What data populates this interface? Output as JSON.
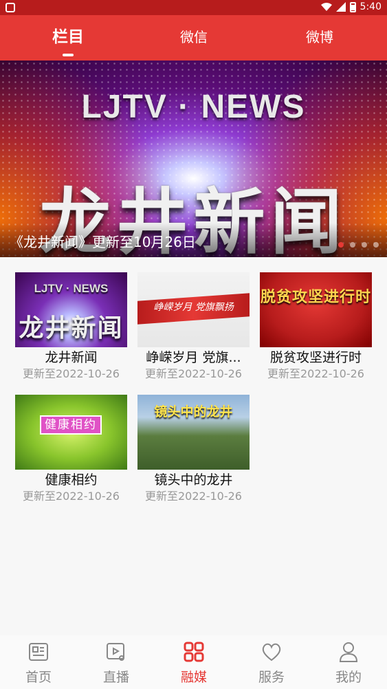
{
  "status_bar": {
    "time": "5:40"
  },
  "header": {
    "tabs": [
      {
        "label": "栏目",
        "active": true
      },
      {
        "label": "微信",
        "active": false
      },
      {
        "label": "微博",
        "active": false
      }
    ]
  },
  "banner": {
    "brand": "LJTV · NEWS",
    "title": "龙井新闻",
    "caption": "《龙井新闻》更新至10月26日",
    "pages": 4,
    "active_page": 1
  },
  "programs": [
    {
      "title": "龙井新闻",
      "updated": "更新至2022-10-26",
      "thumb_brand": "LJTV · NEWS",
      "thumb_title": "龙井新闻"
    },
    {
      "title": "峥嵘岁月 党旗...",
      "updated": "更新至2022-10-26",
      "thumb_text": "峥嵘岁月 党旗飘扬"
    },
    {
      "title": "脱贫攻坚进行时",
      "updated": "更新至2022-10-26",
      "thumb_text": "脱贫攻坚进行时"
    },
    {
      "title": "健康相约",
      "updated": "更新至2022-10-26",
      "thumb_text": "健康相约"
    },
    {
      "title": "镜头中的龙井",
      "updated": "更新至2022-10-26",
      "thumb_text": "镜头中的龙井"
    }
  ],
  "bottom_nav": [
    {
      "label": "首页",
      "icon": "news-icon",
      "active": false
    },
    {
      "label": "直播",
      "icon": "live-video-icon",
      "active": false
    },
    {
      "label": "融媒",
      "icon": "grid-icon",
      "active": true
    },
    {
      "label": "服务",
      "icon": "heart-icon",
      "active": false
    },
    {
      "label": "我的",
      "icon": "user-icon",
      "active": false
    }
  ],
  "colors": {
    "accent": "#e53935",
    "status_bar": "#b71c1c",
    "muted": "#999999"
  }
}
